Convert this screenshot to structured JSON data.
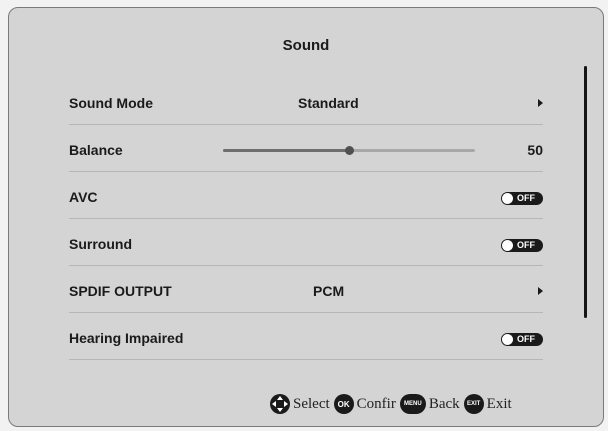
{
  "title": "Sound",
  "rows": [
    {
      "label": "Sound Mode",
      "value": "Standard"
    },
    {
      "label": "Balance",
      "value": "50",
      "level": 0.5
    },
    {
      "label": "AVC",
      "toggle": "OFF"
    },
    {
      "label": "Surround",
      "toggle": "OFF"
    },
    {
      "label": "SPDIF OUTPUT",
      "value": "PCM"
    },
    {
      "label": "Hearing Impaired",
      "toggle": "OFF"
    }
  ],
  "help": {
    "select": {
      "icon": "dpad-icon",
      "label": "Select"
    },
    "confirm": {
      "icon": "OK",
      "label": "Confir"
    },
    "back": {
      "icon": "MENU",
      "label": "Back"
    },
    "exit": {
      "icon": "EXIT",
      "label": "Exit"
    }
  },
  "colors": {
    "background": "#d4d4d4",
    "text": "#1a1a1a",
    "toggle": "#1a1a1a"
  }
}
